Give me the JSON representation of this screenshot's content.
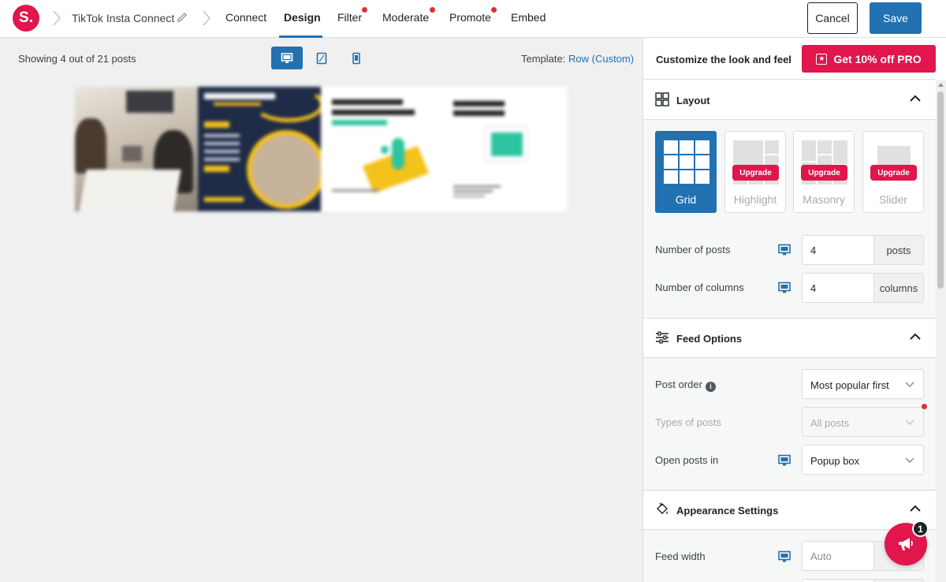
{
  "topbar": {
    "logo_text": "S.",
    "feed_name": "TikTok Insta Connect",
    "nav": [
      {
        "label": "Connect",
        "active": false,
        "dot": false
      },
      {
        "label": "Design",
        "active": true,
        "dot": false
      },
      {
        "label": "Filter",
        "active": false,
        "dot": true
      },
      {
        "label": "Moderate",
        "active": false,
        "dot": true
      },
      {
        "label": "Promote",
        "active": false,
        "dot": true
      },
      {
        "label": "Embed",
        "active": false,
        "dot": false
      }
    ],
    "cancel_label": "Cancel",
    "save_label": "Save"
  },
  "preview": {
    "showing_text": "Showing 4 out of 21 posts",
    "template_label": "Template:",
    "template_value": "Row (Custom)",
    "devices": [
      "desktop",
      "tablet",
      "phone"
    ],
    "active_device": "desktop"
  },
  "sidebar": {
    "header_title": "Customize the look and feel",
    "pro_label": "Get 10% off PRO",
    "layout": {
      "title": "Layout",
      "options": [
        {
          "label": "Grid",
          "active": true,
          "upgrade": false
        },
        {
          "label": "Highlight",
          "active": false,
          "upgrade": true
        },
        {
          "label": "Masonry",
          "active": false,
          "upgrade": true
        },
        {
          "label": "Slider",
          "active": false,
          "upgrade": true
        }
      ],
      "upgrade_label": "Upgrade",
      "num_posts_label": "Number of posts",
      "num_posts_value": "4",
      "num_posts_unit": "posts",
      "num_columns_label": "Number of columns",
      "num_columns_value": "4",
      "num_columns_unit": "columns"
    },
    "feed_options": {
      "title": "Feed Options",
      "post_order_label": "Post order",
      "post_order_value": "Most popular first",
      "types_label": "Types of posts",
      "types_value": "All posts",
      "open_in_label": "Open posts in",
      "open_in_value": "Popup box"
    },
    "appearance": {
      "title": "Appearance Settings",
      "feed_width_label": "Feed width",
      "feed_width_value": "Auto"
    }
  },
  "fab": {
    "badge_count": "1"
  },
  "colors": {
    "accent": "#2271b1",
    "brand": "#e0164d",
    "danger_dot": "#d63638"
  }
}
